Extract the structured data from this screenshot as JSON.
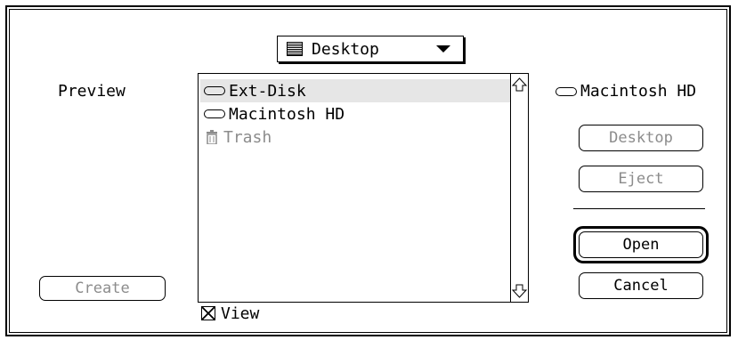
{
  "popup": {
    "label": "Desktop",
    "folder_icon": "folder-icon",
    "arrow_icon": "triangle-down-icon"
  },
  "preview": {
    "label": "Preview",
    "create_label": "Create"
  },
  "file_list": {
    "items": [
      {
        "name": "Ext-Disk",
        "icon": "disk-icon",
        "selected": true
      },
      {
        "name": "Macintosh HD",
        "icon": "disk-icon",
        "selected": false
      },
      {
        "name": "Trash",
        "icon": "trash-icon",
        "disabled": true
      }
    ]
  },
  "volume": {
    "name": "Macintosh HD",
    "icon": "disk-icon"
  },
  "buttons": {
    "desktop": "Desktop",
    "eject": "Eject",
    "open": "Open",
    "cancel": "Cancel"
  },
  "view_checkbox": {
    "label": "View",
    "checked": true
  },
  "colors": {
    "disabled_text": "#8c8c8c",
    "selection": "#e6e6e6"
  }
}
